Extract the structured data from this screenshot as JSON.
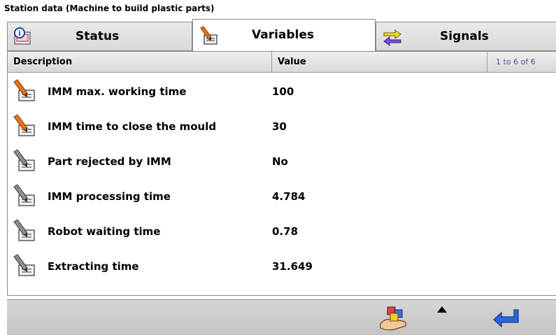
{
  "title": "Station data (Machine to build plastic parts)",
  "tabs": [
    {
      "label": "Status",
      "icon": "info-monitor-icon"
    },
    {
      "label": "Variables",
      "icon": "pencil-edit-icon"
    },
    {
      "label": "Signals",
      "icon": "swap-arrows-icon"
    }
  ],
  "table": {
    "headers": {
      "description": "Description",
      "value": "Value",
      "paging": "1 to 6 of 6"
    },
    "rows": [
      {
        "description": "IMM max. working time",
        "value": "100",
        "icon": "pencil-orange-icon"
      },
      {
        "description": "IMM time to close the mould",
        "value": "30",
        "icon": "pencil-orange-icon"
      },
      {
        "description": "Part rejected by IMM",
        "value": "No",
        "icon": "pencil-gray-icon"
      },
      {
        "description": "IMM processing time",
        "value": "4.784",
        "icon": "pencil-gray-icon"
      },
      {
        "description": "Robot waiting time",
        "value": "0.78",
        "icon": "pencil-gray-icon"
      },
      {
        "description": "Extracting time",
        "value": "31.649",
        "icon": "pencil-gray-icon"
      }
    ]
  },
  "bottombar": {
    "icons": [
      "hand-blocks-icon",
      "scroll-up-arrow-icon",
      "enter-return-icon"
    ]
  },
  "colors": {
    "paging_text": "#6a3fa0",
    "pencil_orange": "#e8731a",
    "accent_blue": "#2a66d9"
  }
}
